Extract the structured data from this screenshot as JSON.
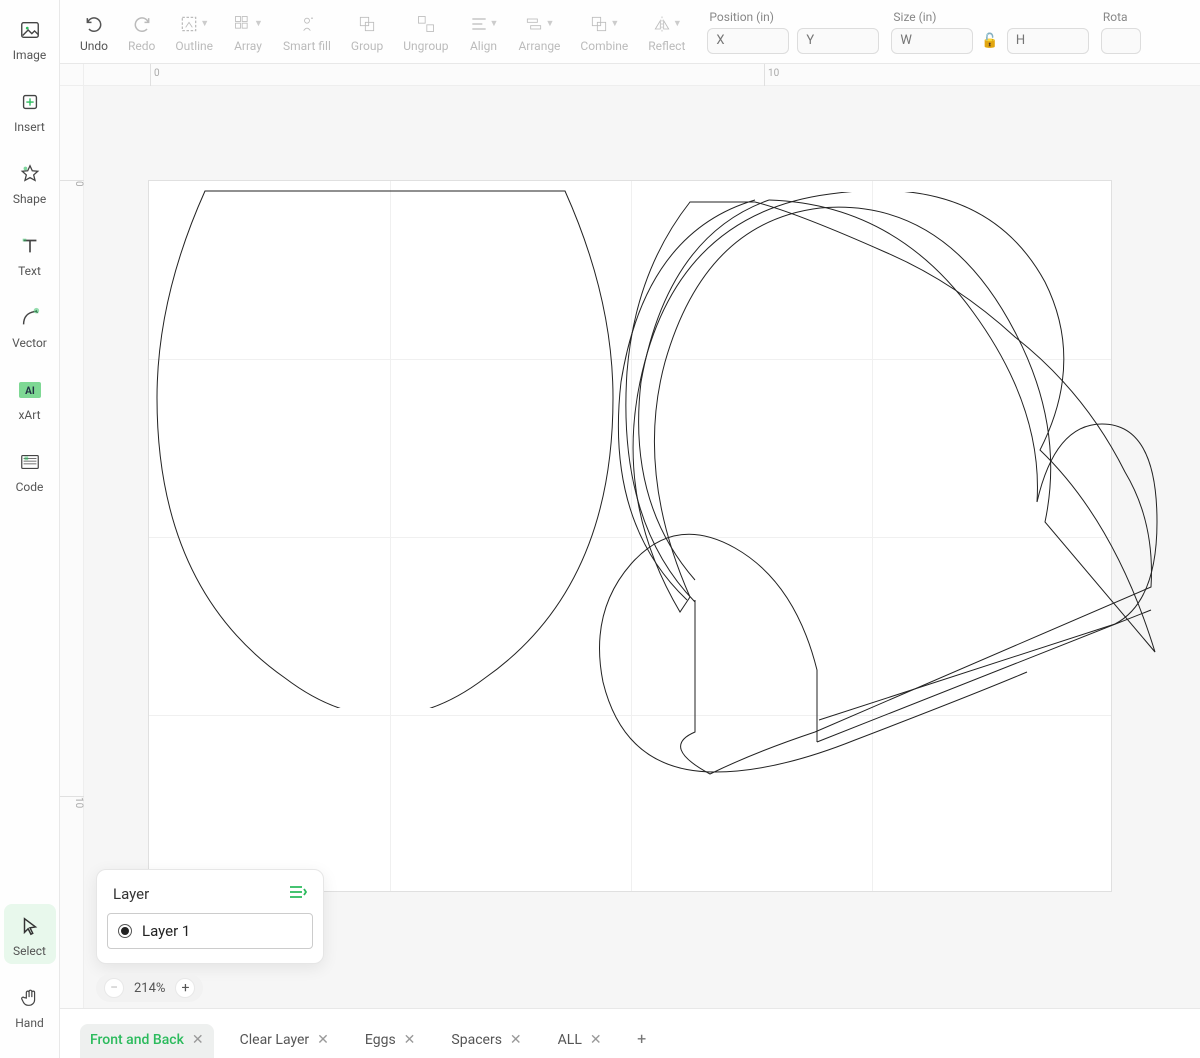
{
  "sidebar": {
    "tools": [
      {
        "id": "image",
        "label": "Image"
      },
      {
        "id": "insert",
        "label": "Insert"
      },
      {
        "id": "shape",
        "label": "Shape"
      },
      {
        "id": "text",
        "label": "Text"
      },
      {
        "id": "vector",
        "label": "Vector"
      },
      {
        "id": "xart",
        "label": "xArt"
      },
      {
        "id": "code",
        "label": "Code"
      }
    ],
    "bottom": [
      {
        "id": "select",
        "label": "Select",
        "active": true
      },
      {
        "id": "hand",
        "label": "Hand"
      }
    ]
  },
  "toolbar": {
    "items": [
      {
        "id": "undo",
        "label": "Undo",
        "enabled": true,
        "dropdown": false
      },
      {
        "id": "redo",
        "label": "Redo",
        "enabled": false,
        "dropdown": false
      },
      {
        "id": "outline",
        "label": "Outline",
        "enabled": false,
        "dropdown": true
      },
      {
        "id": "array",
        "label": "Array",
        "enabled": false,
        "dropdown": true
      },
      {
        "id": "smartfill",
        "label": "Smart fill",
        "enabled": false,
        "dropdown": false
      },
      {
        "id": "group",
        "label": "Group",
        "enabled": false,
        "dropdown": false
      },
      {
        "id": "ungroup",
        "label": "Ungroup",
        "enabled": false,
        "dropdown": false
      },
      {
        "id": "align",
        "label": "Align",
        "enabled": false,
        "dropdown": true
      },
      {
        "id": "arrange",
        "label": "Arrange",
        "enabled": false,
        "dropdown": true
      },
      {
        "id": "combine",
        "label": "Combine",
        "enabled": false,
        "dropdown": true
      },
      {
        "id": "reflect",
        "label": "Reflect",
        "enabled": false,
        "dropdown": true
      }
    ],
    "position": {
      "label": "Position (in)",
      "x_placeholder": "X",
      "y_placeholder": "Y",
      "x": "",
      "y": ""
    },
    "size": {
      "label": "Size (in)",
      "w_placeholder": "W",
      "h_placeholder": "H",
      "w": "",
      "h": ""
    },
    "rotation": {
      "label": "Rota"
    }
  },
  "ruler": {
    "top_ticks": [
      "0",
      "10"
    ],
    "left_ticks": [
      "0",
      "10"
    ]
  },
  "layer_panel": {
    "title": "Layer",
    "layers": [
      {
        "name": "Layer 1",
        "selected": true
      }
    ]
  },
  "zoom": {
    "value": "214%"
  },
  "tabs": [
    {
      "label": "Front and Back",
      "active": true
    },
    {
      "label": "Clear Layer",
      "active": false
    },
    {
      "label": "Eggs",
      "active": false
    },
    {
      "label": "Spacers",
      "active": false
    },
    {
      "label": "ALL",
      "active": false
    }
  ]
}
